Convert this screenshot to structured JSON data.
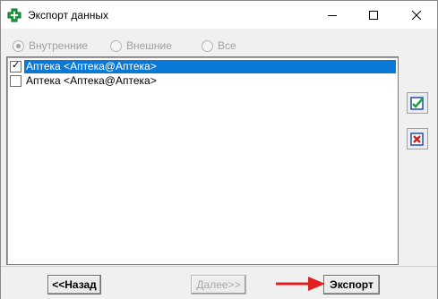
{
  "window": {
    "title": "Экспорт данных"
  },
  "titlebar": {
    "minimize_icon": "minimize-icon",
    "maximize_icon": "maximize-icon",
    "close_icon": "close-icon"
  },
  "filter": {
    "options": [
      {
        "label": "Внутренние",
        "checked": true
      },
      {
        "label": "Внешние",
        "checked": false
      },
      {
        "label": "Все",
        "checked": false
      }
    ]
  },
  "list": {
    "items": [
      {
        "label": "Аптека  <Аптека@Аптека>",
        "checked": true,
        "selected": true
      },
      {
        "label": "Аптека  <Аптека@Аптека>",
        "checked": false,
        "selected": false
      }
    ]
  },
  "side_buttons": {
    "check_all_icon": "check-all-icon",
    "uncheck_all_icon": "uncheck-all-icon"
  },
  "buttons": {
    "back": "<<Назад",
    "next": "Далее>>",
    "export": "Экспорт"
  },
  "colors": {
    "selection": "#0a78d7",
    "arrow": "#e02020"
  }
}
